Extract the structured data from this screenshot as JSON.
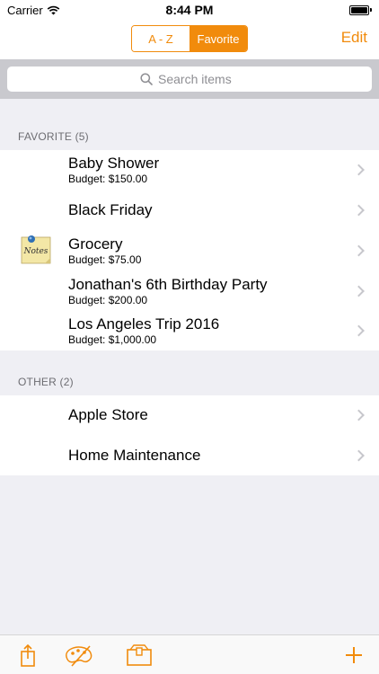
{
  "status_bar": {
    "carrier": "Carrier",
    "time": "8:44 PM"
  },
  "nav": {
    "segments": [
      "A - Z",
      "Favorite"
    ],
    "active_segment": "Favorite",
    "edit_label": "Edit"
  },
  "search": {
    "placeholder": "Search items"
  },
  "sections": [
    {
      "header": "FAVORITE (5)",
      "items": [
        {
          "title": "Baby Shower",
          "subtitle": "Budget: $150.00"
        },
        {
          "title": "Black Friday"
        },
        {
          "title": "Grocery",
          "subtitle": "Budget: $75.00",
          "thumbnail": "notes-sticky-note"
        },
        {
          "title": "Jonathan's 6th Birthday Party",
          "subtitle": "Budget: $200.00"
        },
        {
          "title": "Los Angeles Trip 2016",
          "subtitle": "Budget: $1,000.00"
        }
      ]
    },
    {
      "header": "OTHER (2)",
      "items": [
        {
          "title": "Apple Store"
        },
        {
          "title": "Home Maintenance"
        }
      ]
    }
  ],
  "thumbnail_text": "Notes",
  "toolbar": {
    "icons": [
      "share-icon",
      "palette-icon",
      "wallet-icon",
      "add-icon"
    ]
  },
  "colors": {
    "accent": "#f18b0c",
    "background": "#efeff4",
    "search_bg": "#c9c9ce"
  }
}
